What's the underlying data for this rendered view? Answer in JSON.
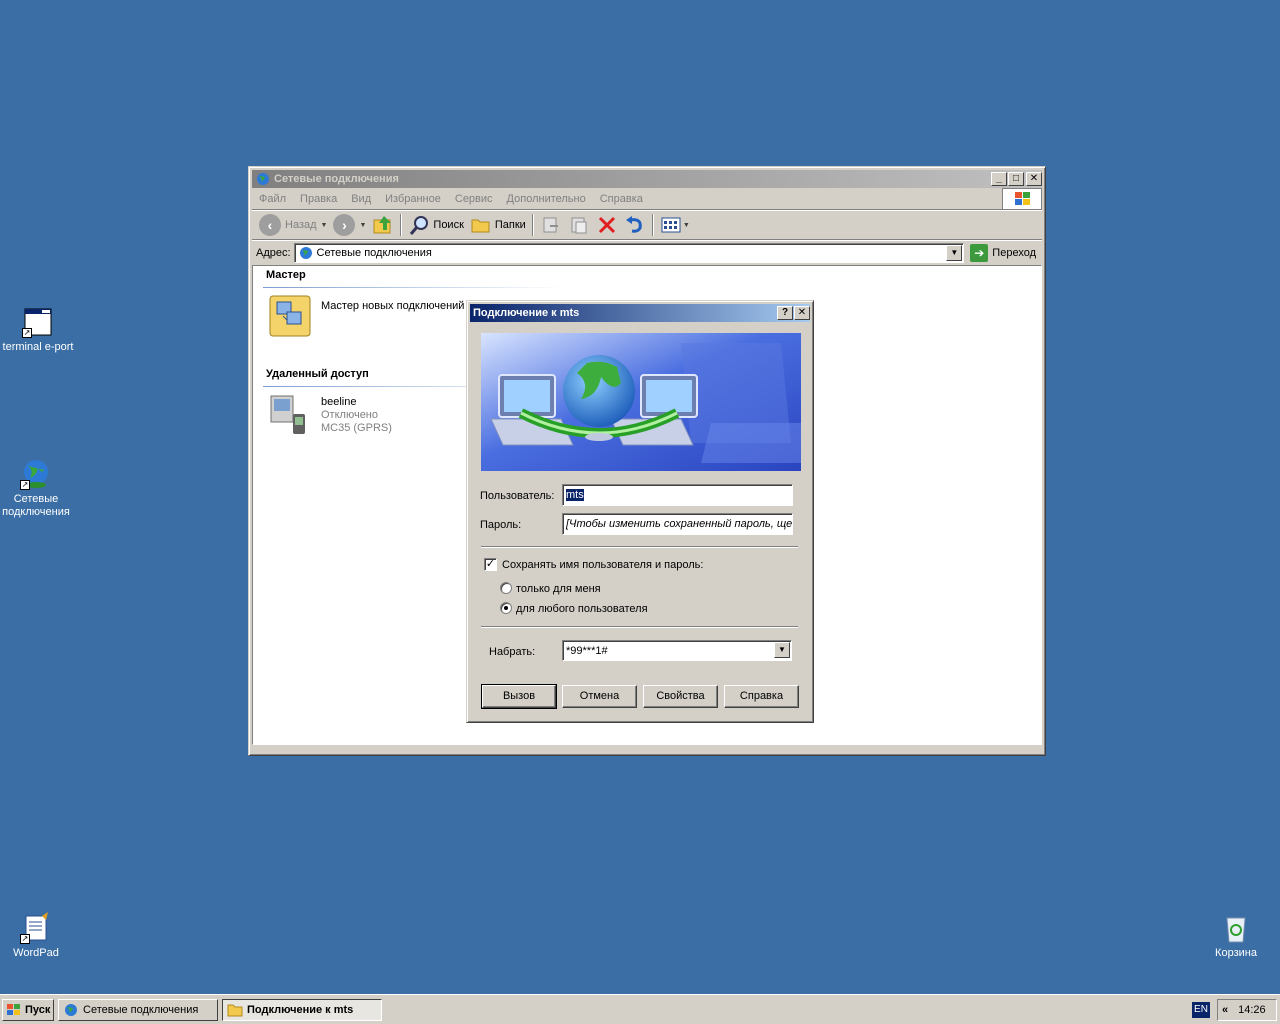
{
  "desktop": {
    "icons": [
      {
        "label": "terminal e-port"
      },
      {
        "label": "Сетевые подключения"
      },
      {
        "label": "WordPad"
      },
      {
        "label": "Корзина"
      }
    ]
  },
  "explorer": {
    "title": "Сетевые подключения",
    "menu": [
      "Файл",
      "Правка",
      "Вид",
      "Избранное",
      "Сервис",
      "Дополнительно",
      "Справка"
    ],
    "toolbar": {
      "back": "Назад",
      "search": "Поиск",
      "folders": "Папки"
    },
    "address": {
      "label": "Адрес:",
      "value": "Сетевые подключения",
      "go": "Переход"
    },
    "groups": {
      "wizard_header": "Мастер",
      "wizard_item": "Мастер новых подключений",
      "remote_header": "Удаленный доступ",
      "conn_name": "beeline",
      "conn_status": "Отключено",
      "conn_device": "MC35 (GPRS)"
    }
  },
  "dialog": {
    "title": "Подключение к mts",
    "user_label": "Пользователь:",
    "user_value": "mts",
    "pass_label": "Пароль:",
    "pass_value": "[Чтобы изменить сохраненный пароль, ще...",
    "save_label": "Сохранять имя пользователя и пароль:",
    "save_checked": true,
    "radio_me": "только для меня",
    "radio_any": "для любого пользователя",
    "dial_label": "Набрать:",
    "dial_value": "*99***1#",
    "buttons": {
      "call": "Вызов",
      "cancel": "Отмена",
      "props": "Свойства",
      "help": "Справка"
    }
  },
  "taskbar": {
    "start": "Пуск",
    "tasks": [
      "Сетевые подключения",
      "Подключение к mts"
    ],
    "lang": "EN",
    "time": "14:26"
  },
  "colors": {
    "desktop": "#3a6ea5",
    "active_title": "#0a246a",
    "face": "#d4d0c8"
  }
}
